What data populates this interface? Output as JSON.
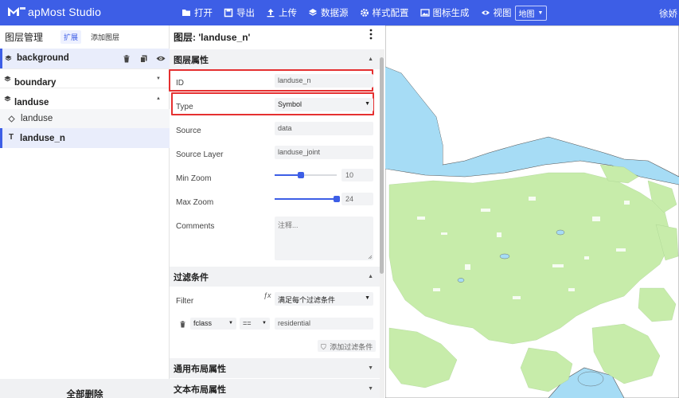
{
  "app": {
    "title": "apMost Studio",
    "user": "徐娇"
  },
  "toolbar": {
    "open": "打开",
    "export": "导出",
    "upload": "上传",
    "datasource": "数据源",
    "style_config": "样式配置",
    "icon_gen": "图标生成",
    "view": "视图",
    "view_select": "地图"
  },
  "left_panel": {
    "title": "图层管理",
    "tab_expand": "扩展",
    "tab_add": "添加图层",
    "layers": [
      {
        "name": "background"
      },
      {
        "name": "boundary"
      },
      {
        "name": "landuse"
      },
      {
        "name": "landuse"
      },
      {
        "name": "landuse_n"
      }
    ],
    "delete_all": "全部删除"
  },
  "layer_panel": {
    "title": "图层: 'landuse_n'",
    "section_props": "图层属性",
    "id_label": "ID",
    "id_value": "landuse_n",
    "type_label": "Type",
    "type_value": "Symbol",
    "source_label": "Source",
    "source_value": "data",
    "source_layer_label": "Source Layer",
    "source_layer_value": "landuse_joint",
    "min_zoom_label": "Min Zoom",
    "min_zoom_value": "10",
    "min_zoom": 10,
    "max_zoom_label": "Max Zoom",
    "max_zoom_value": "24",
    "max_zoom": 24,
    "zoom_range": [
      0,
      24
    ],
    "comments_label": "Comments",
    "comments_placeholder": "注释...",
    "section_filter": "过滤条件",
    "filter_label": "Filter",
    "filter_value": "满足每个过滤条件",
    "filter_field": "fclass",
    "filter_op": "==",
    "filter_val": "residential",
    "add_filter": "添加过滤条件",
    "section_layout": "通用布局属性",
    "section_text": "文本布局属性"
  },
  "colors": {
    "accent": "#3d5ee6",
    "highlight_box": "#e53030",
    "water": "#a6dcf5",
    "land": "#ffffff",
    "landuse": "#c7ecaa"
  }
}
